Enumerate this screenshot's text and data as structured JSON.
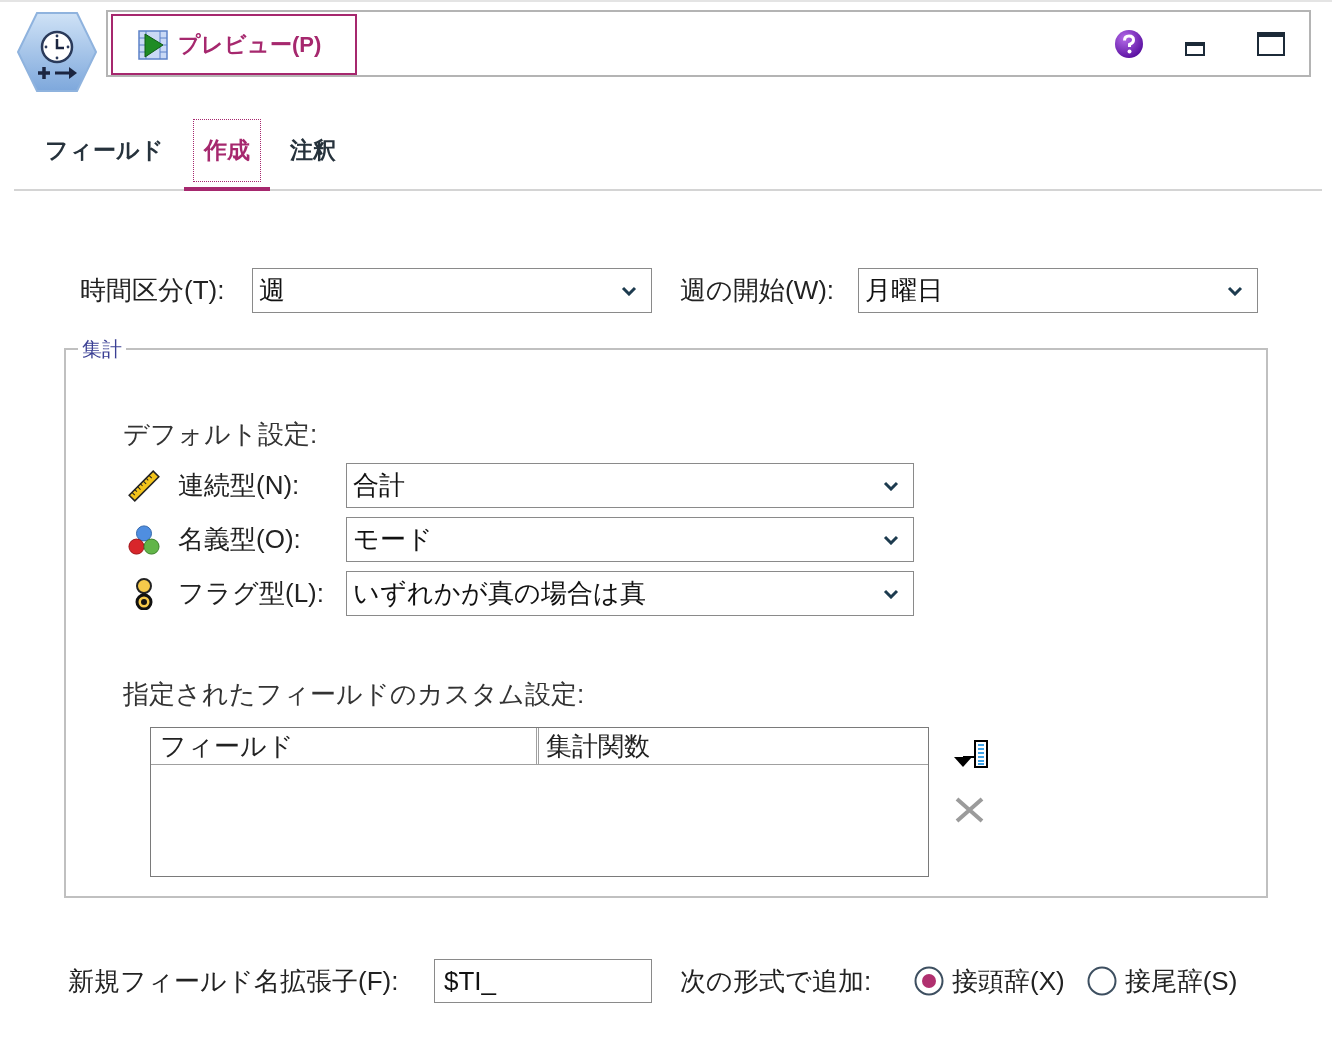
{
  "toolbar": {
    "preview_button": "プレビュー(P)"
  },
  "tabs": [
    {
      "label": "フィールド",
      "selected": false
    },
    {
      "label": "作成",
      "selected": true
    },
    {
      "label": "注釈",
      "selected": false
    }
  ],
  "settings": [
    {
      "label": "時間区分(T):",
      "value": "週"
    },
    {
      "label": "週の開始(W):",
      "value": "月曜日"
    }
  ],
  "aggregation": {
    "legend": "集計",
    "defaults_heading": "デフォルト設定:",
    "defaults": [
      {
        "kind": "continuous",
        "label": "連続型(N):",
        "value": "合計"
      },
      {
        "kind": "nominal",
        "label": "名義型(O):",
        "value": "モード"
      },
      {
        "kind": "flag",
        "label": "フラグ型(L):",
        "value": "いずれかが真の場合は真"
      }
    ],
    "custom_heading": "指定されたフィールドのカスタム設定:",
    "table": {
      "columns": [
        "フィールド",
        "集計関数"
      ],
      "actions": [
        {
          "kind": "add",
          "disabled": false
        },
        {
          "kind": "delete",
          "disabled": true
        }
      ]
    }
  },
  "field_extension": {
    "label": "新規フィールド名拡張子(F):",
    "value": "$TI_"
  },
  "add_as": {
    "label": "次の形式で追加:",
    "options": [
      {
        "label": "接頭辞(X)",
        "selected": true
      },
      {
        "label": "接尾辞(S)",
        "selected": false
      }
    ]
  }
}
